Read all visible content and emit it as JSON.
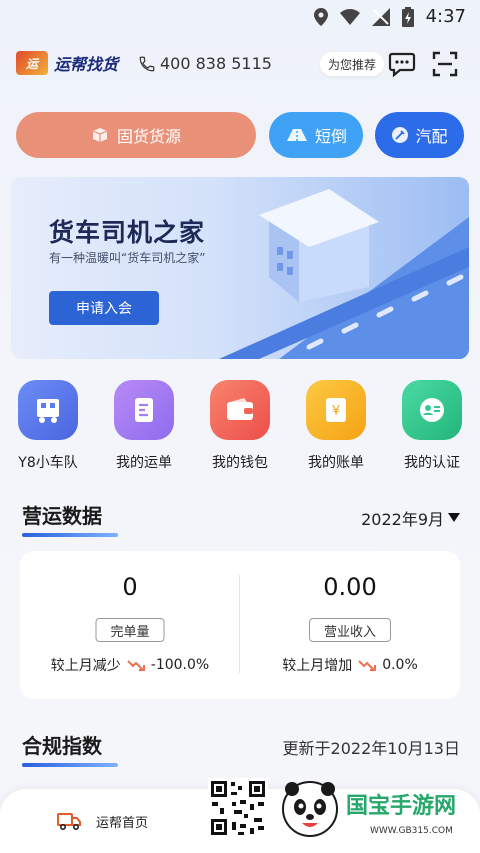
{
  "status_bar": {
    "time": "4:37"
  },
  "header": {
    "logo_mark": "运",
    "logo_text": "运帮找货",
    "phone": "400 838 5115",
    "recommend_label": "为您推荐"
  },
  "quick_buttons": {
    "main": "固货货源",
    "short": "短倒",
    "parts": "汽配"
  },
  "banner": {
    "title": "货车司机之家",
    "subtitle": "有一种温暖叫“货车司机之家”",
    "button": "申请入会"
  },
  "shortcuts": [
    {
      "label": "Y8小车队",
      "icon": "truck-icon",
      "color": "#5b7cf0"
    },
    {
      "label": "我的运单",
      "icon": "document-icon",
      "color": "#a77ff0"
    },
    {
      "label": "我的钱包",
      "icon": "wallet-icon",
      "color": "#f2665a"
    },
    {
      "label": "我的账单",
      "icon": "bill-icon",
      "color": "#f7b627"
    },
    {
      "label": "我的认证",
      "icon": "id-card-icon",
      "color": "#35c98f"
    }
  ],
  "operations": {
    "title": "营运数据",
    "month": "2022年9月",
    "stats": [
      {
        "value": "0",
        "label": "完单量",
        "comparison": "较上月减少",
        "change": "-100.0%"
      },
      {
        "value": "0.00",
        "label": "营业收入",
        "comparison": "较上月增加",
        "change": "0.0%"
      }
    ]
  },
  "compliance": {
    "title": "合规指数",
    "updated": "更新于2022年10月13日"
  },
  "bottom_nav": {
    "home_label": "运帮首页"
  },
  "watermark": {
    "brand": "国宝手游网",
    "url": "WWW.GB315.COM"
  },
  "colors": {
    "accent": "#2c63d5",
    "orange": "#e99178",
    "sky": "#3fa2f4",
    "blue": "#2c6ce8"
  }
}
